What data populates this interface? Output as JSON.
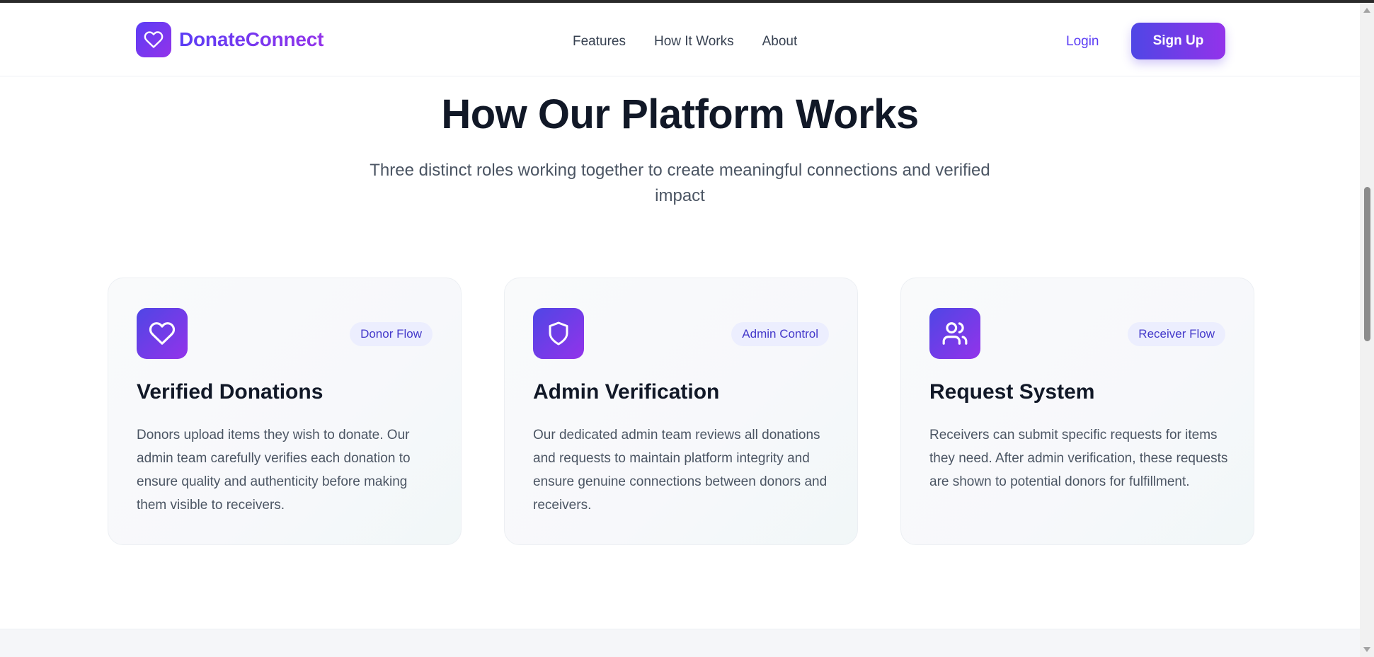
{
  "brand": {
    "name": "DonateConnect",
    "logo_icon": "heart-icon"
  },
  "nav": {
    "links": [
      "Features",
      "How It Works",
      "About"
    ],
    "login": "Login",
    "signup": "Sign Up"
  },
  "section": {
    "title": "How Our Platform Works",
    "subtitle": "Three distinct roles working together to create meaningful connections and verified impact"
  },
  "cards": [
    {
      "icon": "heart-icon",
      "badge": "Donor Flow",
      "title": "Verified Donations",
      "text": "Donors upload items they wish to donate. Our admin team carefully verifies each donation to ensure quality and authenticity before making them visible to receivers."
    },
    {
      "icon": "shield-icon",
      "badge": "Admin Control",
      "title": "Admin Verification",
      "text": "Our dedicated admin team reviews all donations and requests to maintain platform integrity and ensure genuine connections between donors and receivers."
    },
    {
      "icon": "users-icon",
      "badge": "Receiver Flow",
      "title": "Request System",
      "text": "Receivers can submit specific requests for items they need. After admin verification, these requests are shown to potential donors for fulfillment."
    }
  ],
  "colors": {
    "brand_start": "#5b3df5",
    "brand_end": "#9333ea",
    "badge_bg": "#eceefe",
    "badge_text": "#4338ca"
  }
}
